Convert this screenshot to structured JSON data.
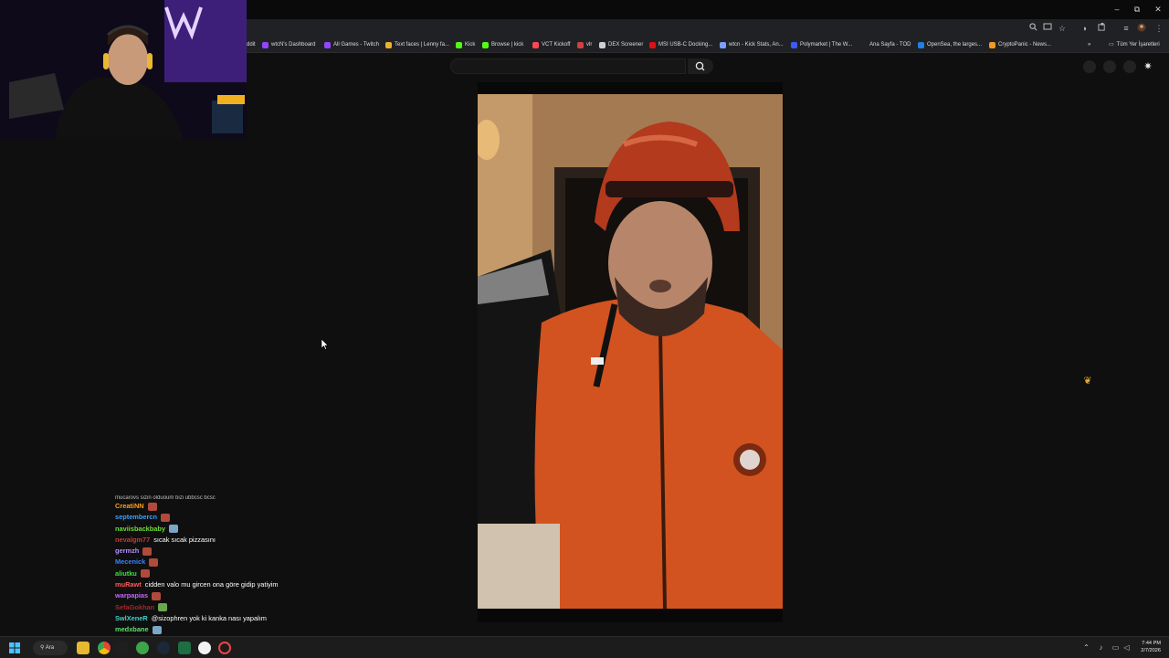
{
  "window": {
    "minimize_glyph": "–",
    "maximize_glyph": "⧉",
    "close_glyph": "✕"
  },
  "bookmarks": [
    {
      "label": "ddit",
      "icon": "reddit-icon",
      "color": "#ff4500"
    },
    {
      "label": "wtcN's Dashboard",
      "icon": "twitch-icon",
      "color": "#9146ff"
    },
    {
      "label": "All Games - Twitch",
      "icon": "twitch-icon",
      "color": "#9146ff"
    },
    {
      "label": "Text faces | Lenny fa...",
      "icon": "lenny-face-icon",
      "color": "#e8b130"
    },
    {
      "label": "Kick",
      "icon": "kick-icon",
      "color": "#53fc18"
    },
    {
      "label": "Browse | kick",
      "icon": "kick-icon",
      "color": "#53fc18"
    },
    {
      "label": "VCT Kickoff",
      "icon": "valorant-icon",
      "color": "#ff4655"
    },
    {
      "label": "vlr",
      "icon": "vlr-icon",
      "color": "#d34040"
    },
    {
      "label": "DEX Screener",
      "icon": "dexscreener-icon",
      "color": "#cfcfcf"
    },
    {
      "label": "MSI USB-C Docking...",
      "icon": "msi-icon",
      "color": "#d11"
    },
    {
      "label": "wtcn - Kick Stats, An...",
      "icon": "stats-icon",
      "color": "#7aa0ff"
    },
    {
      "label": "Polymarket | The W...",
      "icon": "polymarket-icon",
      "color": "#3b5bff"
    },
    {
      "label": "Ana Sayfa - TOD",
      "icon": "tod-icon",
      "color": "#222"
    },
    {
      "label": "OpenSea, the larges...",
      "icon": "opensea-icon",
      "color": "#2081e2"
    },
    {
      "label": "CryptoPanic - News...",
      "icon": "cryptopanic-icon",
      "color": "#f29a1f"
    }
  ],
  "bookmarks_overflow_glyph": "»",
  "all_bookmarks_label": "Tüm Yer İşaretleri",
  "search": {
    "placeholder": ""
  },
  "chat": {
    "partial_top_line": "mucarovs  sizin olduoum bizi ubbcsc bcsc",
    "messages": [
      {
        "user": "CreatiNN",
        "color": "#ff9f1c",
        "text": "",
        "emote": "pizza-emote"
      },
      {
        "user": "septembercn",
        "color": "#3aa0ff",
        "text": "",
        "emote": "pizza-emote"
      },
      {
        "user": "naviisbackbaby",
        "color": "#6fdc3a",
        "text": "",
        "emote": "face-emote"
      },
      {
        "user": "nevalgm77",
        "color": "#c83838",
        "text": "sıcak sıcak pizzasını",
        "emote": ""
      },
      {
        "user": "germzh",
        "color": "#b48cff",
        "text": "",
        "emote": "pizza-emote"
      },
      {
        "user": "Mecenick",
        "color": "#3a7fff",
        "text": "",
        "emote": "pizza-emote"
      },
      {
        "user": "aliutku",
        "color": "#3ae13a",
        "text": "",
        "emote": "pizza-emote"
      },
      {
        "user": "muRawt",
        "color": "#ff5a5a",
        "text": "cidden valo mu gircen ona göre gidip yatiyim",
        "emote": ""
      },
      {
        "user": "warpapias",
        "color": "#c964ff",
        "text": "",
        "emote": "pizza-emote"
      },
      {
        "user": "SefaGokhan",
        "color": "#a0282f",
        "text": "",
        "emote": "gg-emote"
      },
      {
        "user": "SwlXeneR",
        "color": "#45d0c8",
        "text": "@sizophren yok ki kanka nası yapalım",
        "emote": ""
      },
      {
        "user": "medxbane",
        "color": "#5de06b",
        "text": "",
        "emote": "face-emote"
      }
    ]
  },
  "taskbar": {
    "search_label": "Ara",
    "time": "7:44 PM",
    "date": "2/7/2026",
    "apps": [
      "start-icon",
      "search-icon",
      "file-explorer-icon",
      "chrome-icon",
      "green-app-icon",
      "steam-icon",
      "excel-icon",
      "obs-icon",
      "refresh-app-icon"
    ]
  },
  "colors": {
    "page_bg": "#0f0f0f",
    "chrome_bg": "#202124",
    "accent_purple": "#9146ff"
  }
}
